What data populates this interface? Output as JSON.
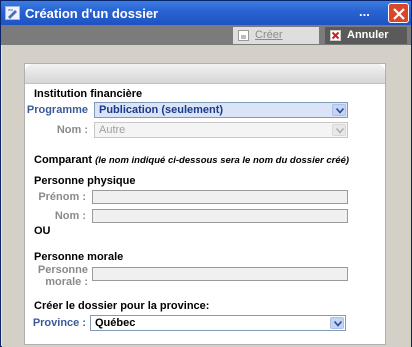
{
  "window": {
    "title": "Création d'un dossier",
    "dots": "...",
    "accent": "#2a64d4"
  },
  "toolbar": {
    "create_label": "Créer",
    "cancel_label": "Annuler"
  },
  "form": {
    "institution": {
      "heading": "Institution financière",
      "programme_label": "Programme",
      "programme_value": "Publication (seulement)",
      "nom_label": "Nom :",
      "nom_value": "Autre"
    },
    "comparant": {
      "heading": "Comparant",
      "note": "(le nom indiqué ci-dessous sera le nom du dossier créé)"
    },
    "personne_physique": {
      "heading": "Personne physique",
      "prenom_label": "Prénom :",
      "nom_label": "Nom :",
      "prenom_value": "",
      "nom_value": "",
      "or_label": "OU"
    },
    "personne_morale": {
      "heading": "Personne morale",
      "label_line1": "Personne",
      "label_line2": "morale :",
      "value": ""
    },
    "province": {
      "heading": "Créer le dossier pour la province:",
      "label": "Province :",
      "value": "Québec"
    }
  }
}
